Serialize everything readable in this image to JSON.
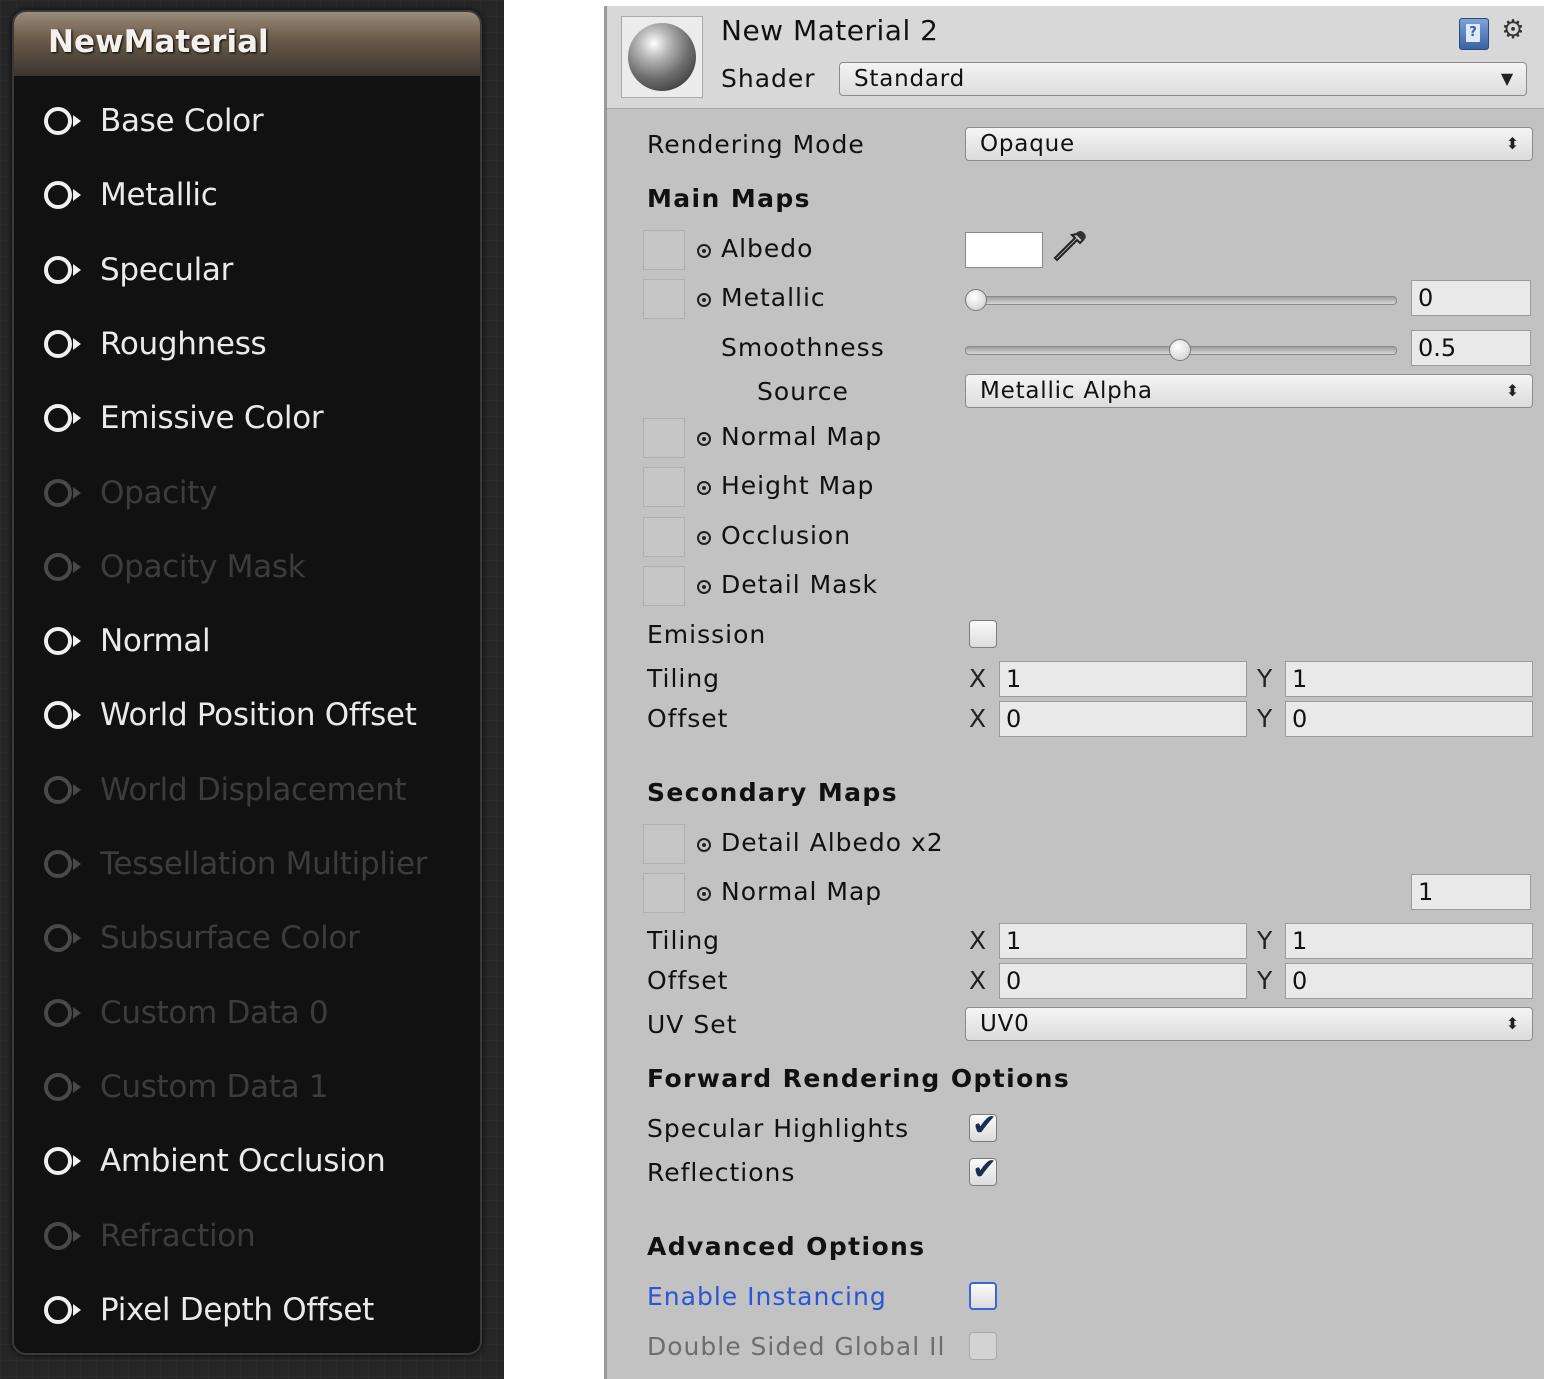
{
  "node": {
    "title": "NewMaterial",
    "pins": [
      {
        "label": "Base Color",
        "enabled": true
      },
      {
        "label": "Metallic",
        "enabled": true
      },
      {
        "label": "Specular",
        "enabled": true
      },
      {
        "label": "Roughness",
        "enabled": true
      },
      {
        "label": "Emissive Color",
        "enabled": true
      },
      {
        "label": "Opacity",
        "enabled": false
      },
      {
        "label": "Opacity Mask",
        "enabled": false
      },
      {
        "label": "Normal",
        "enabled": true
      },
      {
        "label": "World Position Offset",
        "enabled": true
      },
      {
        "label": "World Displacement",
        "enabled": false
      },
      {
        "label": "Tessellation Multiplier",
        "enabled": false
      },
      {
        "label": "Subsurface Color",
        "enabled": false
      },
      {
        "label": "Custom Data 0",
        "enabled": false
      },
      {
        "label": "Custom Data 1",
        "enabled": false
      },
      {
        "label": "Ambient Occlusion",
        "enabled": true
      },
      {
        "label": "Refraction",
        "enabled": false
      },
      {
        "label": "Pixel Depth Offset",
        "enabled": true
      }
    ]
  },
  "inspector": {
    "material_name": "New Material 2",
    "shader_label": "Shader",
    "shader_value": "Standard",
    "rendering_mode_label": "Rendering Mode",
    "rendering_mode_value": "Opaque",
    "main_maps": {
      "title": "Main Maps",
      "albedo": "Albedo",
      "albedo_color": "#ffffff",
      "metallic": "Metallic",
      "metallic_value": "0",
      "metallic_fraction": 0,
      "smoothness": "Smoothness",
      "smoothness_value": "0.5",
      "smoothness_fraction": 0.5,
      "source": "Source",
      "source_value": "Metallic Alpha",
      "normal_map": "Normal Map",
      "height_map": "Height Map",
      "occlusion": "Occlusion",
      "detail_mask": "Detail Mask",
      "emission": "Emission",
      "emission_checked": false,
      "tiling": "Tiling",
      "tiling_x": "1",
      "tiling_y": "1",
      "offset": "Offset",
      "offset_x": "0",
      "offset_y": "0"
    },
    "secondary_maps": {
      "title": "Secondary Maps",
      "detail_albedo": "Detail Albedo x2",
      "normal_map": "Normal Map",
      "normal_scale": "1",
      "tiling": "Tiling",
      "tiling_x": "1",
      "tiling_y": "1",
      "offset": "Offset",
      "offset_x": "0",
      "offset_y": "0",
      "uv_set": "UV Set",
      "uv_set_value": "UV0"
    },
    "forward_rendering": {
      "title": "Forward Rendering Options",
      "specular_highlights": "Specular Highlights",
      "specular_checked": true,
      "reflections": "Reflections",
      "reflections_checked": true
    },
    "advanced": {
      "title": "Advanced Options",
      "enable_instancing": "Enable Instancing",
      "enable_instancing_checked": false,
      "double_sided_gi": "Double Sided Global Il",
      "double_sided_checked": false
    },
    "axis_x": "X",
    "axis_y": "Y",
    "accent_color": "#2756d8"
  }
}
